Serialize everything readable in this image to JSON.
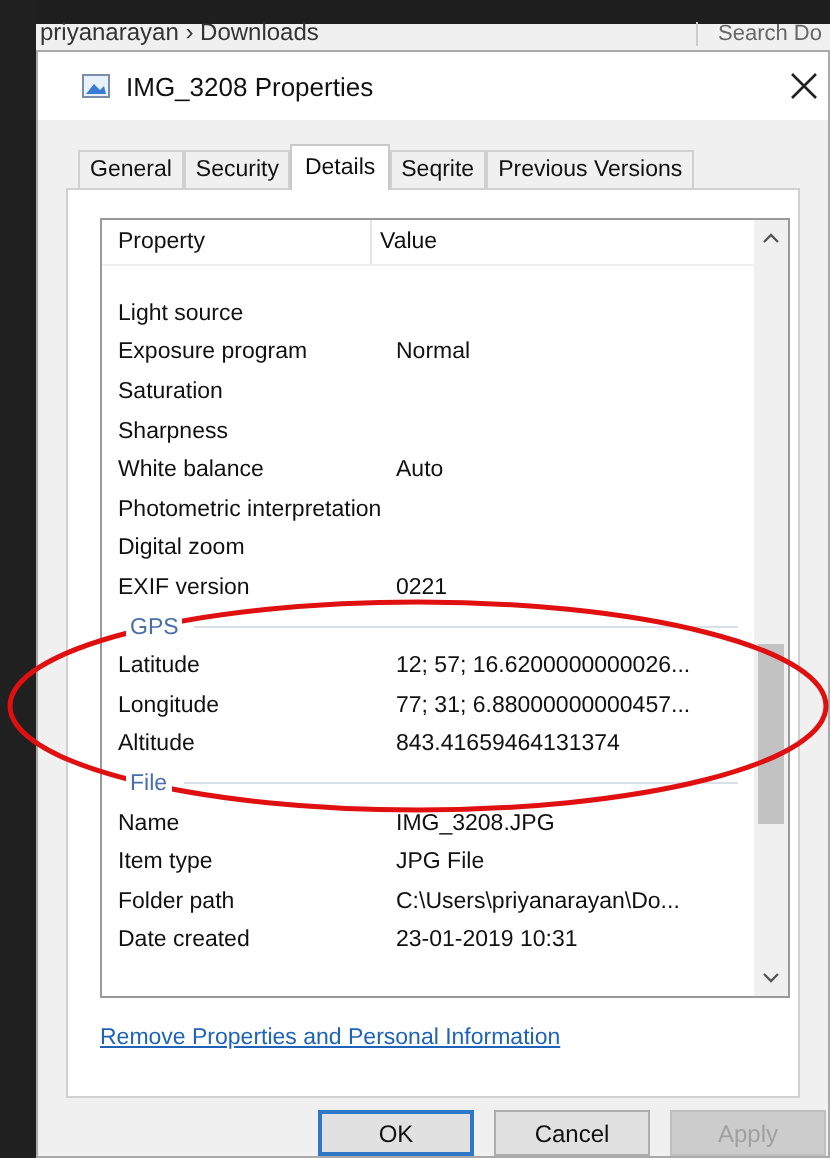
{
  "background_window": {
    "breadcrumb": "priyanarayan  ›  Downloads",
    "search": "Search Do"
  },
  "window": {
    "title": "IMG_3208 Properties"
  },
  "tabs": [
    {
      "label": "General",
      "selected": false
    },
    {
      "label": "Security",
      "selected": false
    },
    {
      "label": "Details",
      "selected": true
    },
    {
      "label": "Seqrite",
      "selected": false
    },
    {
      "label": "Previous Versions",
      "selected": false
    }
  ],
  "table": {
    "columns": [
      "Property",
      "Value"
    ],
    "rows": [
      {
        "kind": "item",
        "property": "Light source",
        "value": ""
      },
      {
        "kind": "item",
        "property": "Exposure program",
        "value": "Normal"
      },
      {
        "kind": "item",
        "property": "Saturation",
        "value": ""
      },
      {
        "kind": "item",
        "property": "Sharpness",
        "value": ""
      },
      {
        "kind": "item",
        "property": "White balance",
        "value": "Auto"
      },
      {
        "kind": "item",
        "property": "Photometric interpretation",
        "value": ""
      },
      {
        "kind": "item",
        "property": "Digital zoom",
        "value": ""
      },
      {
        "kind": "item",
        "property": "EXIF version",
        "value": "0221"
      },
      {
        "kind": "group",
        "property": "GPS"
      },
      {
        "kind": "item",
        "property": "Latitude",
        "value": "12; 57; 16.6200000000026..."
      },
      {
        "kind": "item",
        "property": "Longitude",
        "value": "77; 31; 6.88000000000457..."
      },
      {
        "kind": "item",
        "property": "Altitude",
        "value": "843.41659464131374"
      },
      {
        "kind": "group",
        "property": "File"
      },
      {
        "kind": "item",
        "property": "Name",
        "value": "IMG_3208.JPG"
      },
      {
        "kind": "item",
        "property": "Item type",
        "value": "JPG File"
      },
      {
        "kind": "item",
        "property": "Folder path",
        "value": "C:\\Users\\priyanarayan\\Do..."
      },
      {
        "kind": "item",
        "property": "Date created",
        "value": "23-01-2019 10:31"
      }
    ]
  },
  "link": "Remove Properties and Personal Information",
  "buttons": [
    {
      "label": "OK",
      "default": true,
      "disabled": false
    },
    {
      "label": "Cancel",
      "default": false,
      "disabled": false
    },
    {
      "label": "Apply",
      "default": false,
      "disabled": true
    }
  ]
}
